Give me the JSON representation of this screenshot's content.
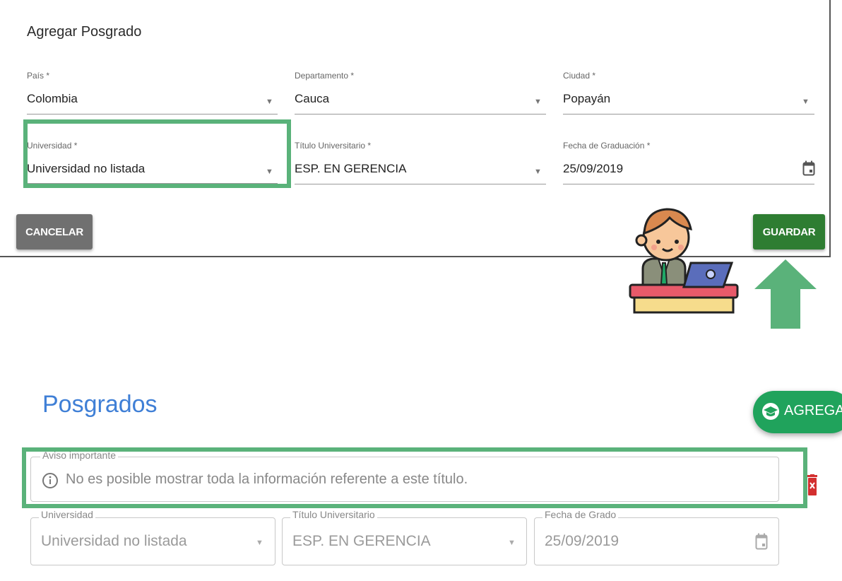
{
  "dialog": {
    "title": "Agregar Posgrado",
    "fields": {
      "pais": {
        "label": "País *",
        "value": "Colombia"
      },
      "departamento": {
        "label": "Departamento *",
        "value": "Cauca"
      },
      "ciudad": {
        "label": "Ciudad *",
        "value": "Popayán"
      },
      "universidad": {
        "label": "Universidad *",
        "value": "Universidad no listada"
      },
      "titulo": {
        "label": "Título Universitario *",
        "value": "ESP. EN GERENCIA"
      },
      "fecha": {
        "label": "Fecha de Graduación *",
        "value": "25/09/2019"
      }
    },
    "cancel_label": "CANCELAR",
    "save_label": "GUARDAR"
  },
  "posgrados": {
    "title": "Posgrados",
    "add_label": "AGREGAR",
    "notice": {
      "legend": "Aviso importante",
      "text": "No es posible mostrar toda la información referente a este título."
    },
    "record": {
      "universidad": {
        "label": "Universidad",
        "value": "Universidad no listada"
      },
      "titulo": {
        "label": "Título Universitario",
        "value": "ESP. EN GERENCIA"
      },
      "fecha": {
        "label": "Fecha de Grado",
        "value": "25/09/2019"
      }
    }
  },
  "icons": {
    "calendar": "calendar-icon",
    "info": "info-icon",
    "delete": "trash-icon",
    "graduation": "graduation-cap-icon",
    "arrow": "arrow-up-icon",
    "character": "office-worker-illustration"
  },
  "colors": {
    "highlight": "#5ab27a",
    "save_button": "#2e7d32",
    "cancel_button": "#707070",
    "add_button": "#20a35c",
    "title_blue": "#3f7fd6",
    "delete_red": "#d32f2f"
  }
}
